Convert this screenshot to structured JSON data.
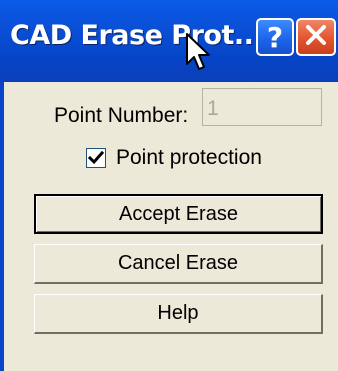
{
  "window": {
    "title": "CAD Erase Prot...",
    "help_glyph": "?",
    "close_glyph": "✕"
  },
  "form": {
    "point_number_label": "Point Number:",
    "point_number_value": "1",
    "point_protection_label": "Point protection",
    "point_protection_checked": true
  },
  "buttons": {
    "accept": "Accept Erase",
    "cancel": "Cancel Erase",
    "help": "Help"
  },
  "icons": {
    "help": "help-icon",
    "close": "close-icon",
    "cursor": "mouse-cursor-icon",
    "check": "checkmark-icon"
  },
  "colors": {
    "titlebar": "#0a4fd6",
    "close_button": "#e2552e",
    "help_button": "#1b63e6",
    "dialog_face": "#ece9d8",
    "disabled_text": "#aca899"
  }
}
